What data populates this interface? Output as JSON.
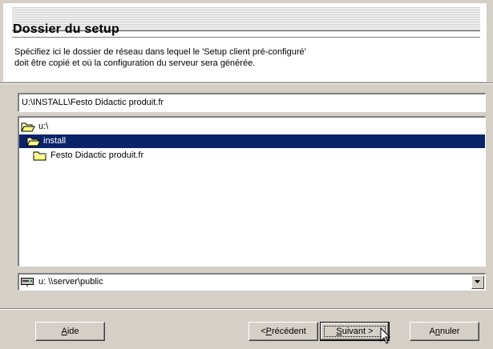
{
  "header": {
    "title": "Dossier du setup",
    "description_line1": "Spécifiez ici le dossier de réseau dans lequel le 'Setup client pré-configuré'",
    "description_line2": "doit être copié et où la configuration du serveur sera générée."
  },
  "path_field": {
    "value": "U:\\INSTALL\\Festo Didactic produit.fr"
  },
  "folder_list": {
    "items": [
      {
        "label": "u:\\",
        "icon": "open-folder-icon",
        "selected": false
      },
      {
        "label": "install",
        "icon": "open-folder-icon",
        "selected": true
      },
      {
        "label": "Festo Didactic produit.fr",
        "icon": "folder-icon",
        "selected": false
      }
    ],
    "selected_bg": "#0a246a"
  },
  "drive_combo": {
    "selected": "u:  \\\\server\\public",
    "icon": "network-drive-icon"
  },
  "buttons": {
    "aide": {
      "prefix": "",
      "accel": "A",
      "rest": "ide"
    },
    "precedent": {
      "prefix": "<",
      "accel": "P",
      "rest": "récédent"
    },
    "suivant": {
      "prefix": "",
      "accel": "S",
      "rest": "uivant >"
    },
    "annuler": {
      "prefix": "A",
      "accel": "n",
      "rest": "nuler"
    }
  },
  "colors": {
    "dialog_bg": "#d4d0c8",
    "selection": "#0a246a"
  }
}
